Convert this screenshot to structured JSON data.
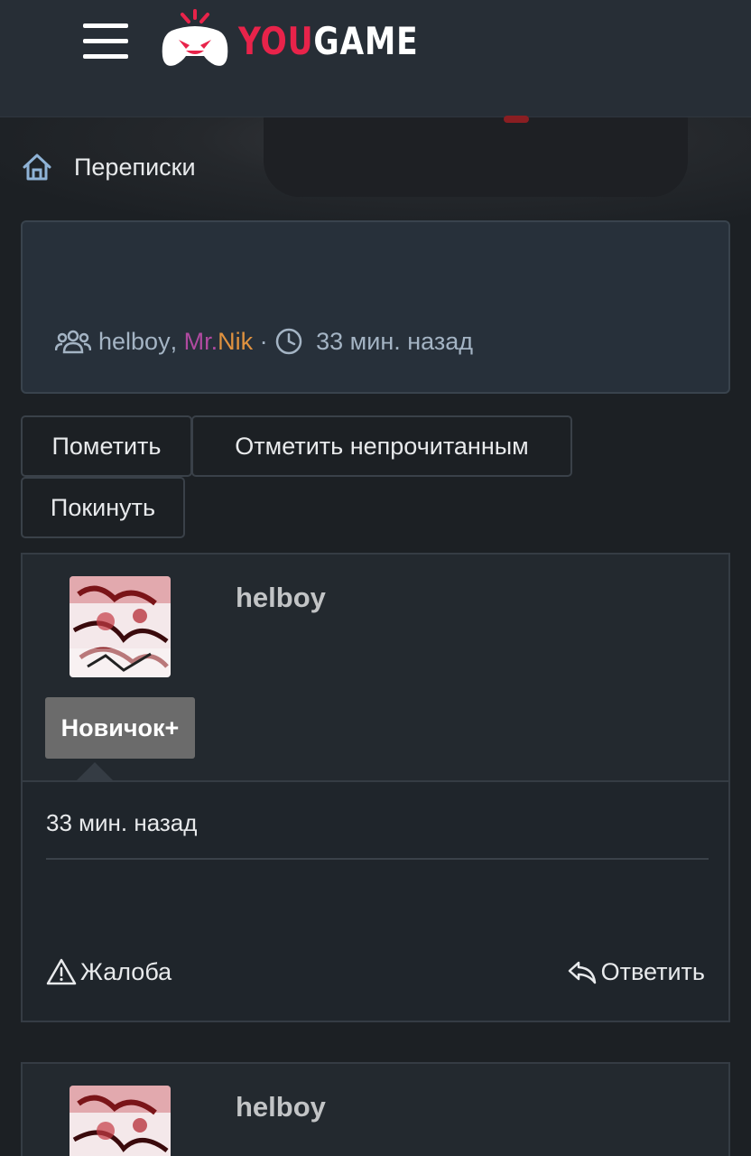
{
  "header": {
    "logo_you": "YOU",
    "logo_game": "GAME"
  },
  "breadcrumb": {
    "label": "Переписки"
  },
  "conversation": {
    "participant_1": "helboy",
    "separator": ",",
    "participant_2_part1": "Mr.",
    "participant_2_part2": "Nik",
    "dot": "·",
    "time": "33 мин. назад"
  },
  "actions": {
    "mark": "Пометить",
    "mark_unread": "Отметить непрочитанным",
    "leave": "Покинуть"
  },
  "messages": [
    {
      "username": "helboy",
      "rank": "Новичок+",
      "time": "33 мин. назад",
      "report": "Жалоба",
      "reply": "Ответить"
    },
    {
      "username": "helboy"
    }
  ],
  "colors": {
    "accent_red": "#e8234a",
    "mr_color": "#b04aa0",
    "nik_color": "#e0923f"
  }
}
